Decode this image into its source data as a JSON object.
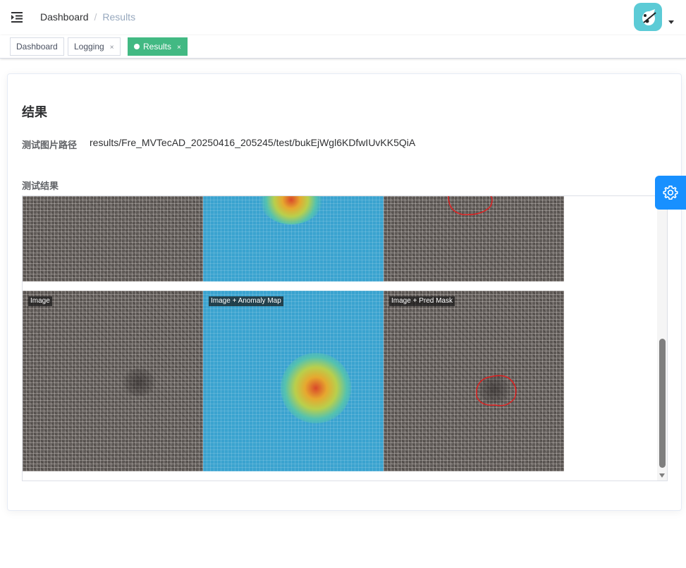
{
  "navbar": {
    "breadcrumb": {
      "home": "Dashboard",
      "separator": "/",
      "current": "Results"
    }
  },
  "tags": [
    {
      "label": "Dashboard",
      "close": ""
    },
    {
      "label": "Logging",
      "close": "×"
    },
    {
      "label": "Results",
      "close": "×",
      "active": true
    }
  ],
  "card": {
    "title": "结果",
    "path_label": "测试图片路径",
    "path_value": "results/Fre_MVTecAD_20250416_205245/test/bukEjWgl6KDfwIUvKK5QiA",
    "result_label": "测试结果"
  },
  "result_images": {
    "captions": [
      "Image",
      "Image + Anomaly Map",
      "Image + Pred Mask"
    ]
  },
  "colors": {
    "accent_tag": "#42b983",
    "settings_button": "#1890ff",
    "avatar_bg": "#5ccbd6",
    "mask_outline": "#e02020"
  },
  "icons": {
    "hamburger": "hamburger-icon",
    "settings": "gear-icon",
    "dropdown": "caret-down-icon"
  }
}
